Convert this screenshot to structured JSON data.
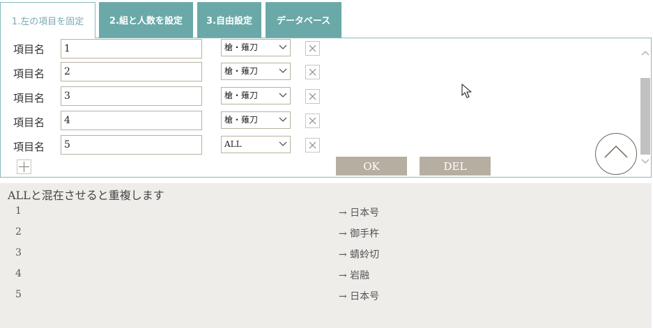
{
  "tabs": [
    {
      "label": "1.左の項目を固定",
      "active": true
    },
    {
      "label": "2.組と人数を設定",
      "active": false
    },
    {
      "label": "3.自由設定",
      "active": false
    },
    {
      "label": "データベース",
      "active": false
    }
  ],
  "rows": [
    {
      "label": "項目名",
      "value": "1",
      "select": "槍・薙刀"
    },
    {
      "label": "項目名",
      "value": "2",
      "select": "槍・薙刀"
    },
    {
      "label": "項目名",
      "value": "3",
      "select": "槍・薙刀"
    },
    {
      "label": "項目名",
      "value": "4",
      "select": "槍・薙刀"
    },
    {
      "label": "項目名",
      "value": "5",
      "select": "ALL"
    }
  ],
  "buttons": {
    "ok": "OK",
    "del": "DEL"
  },
  "results": {
    "title": "ALLと混在させると重複します",
    "items": [
      {
        "num": "1",
        "value": "→ 日本号"
      },
      {
        "num": "2",
        "value": "→ 御手杵"
      },
      {
        "num": "3",
        "value": "→ 蜻蛉切"
      },
      {
        "num": "4",
        "value": "→ 岩融"
      },
      {
        "num": "5",
        "value": "→ 日本号"
      }
    ]
  },
  "icons": {
    "remove": "close-icon",
    "add": "plus-icon",
    "dropdown": "chevron-down-icon",
    "scroll_top": "chevron-up-icon",
    "cursor": "mouse-cursor-icon"
  },
  "colors": {
    "tab_bg": "#6aa9a8",
    "panel_border": "#86b9bc",
    "action_button": "#b6aea1",
    "results_bg": "#efedea"
  }
}
